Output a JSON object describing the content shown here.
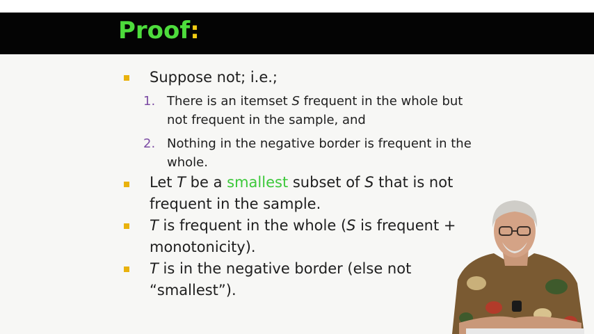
{
  "title": {
    "text": "Proof",
    "colon": ":"
  },
  "bullets": {
    "b1": "Suppose not; i.e.;",
    "n1_num": "1.",
    "n1_a": "There is an itemset ",
    "n1_S": "S",
    "n1_b": " frequent in the whole but",
    "n1_line2": "not frequent in the sample, and",
    "n2_num": "2.",
    "n2_line1": "Nothing in the negative border is frequent in the",
    "n2_line2": "whole.",
    "b2_a": "Let ",
    "b2_T": "T",
    "b2_b": " be a ",
    "b2_smallest": "smallest",
    "b2_c": " subset of ",
    "b2_S": "S",
    "b2_d": " that is not",
    "b2_line2": "frequent in the sample.",
    "b3_T": "T",
    "b3_a": " is frequent in the whole (",
    "b3_S": "S",
    "b3_b": " is frequent +",
    "b3_line2": "monotonicity).",
    "b4_T": "T",
    "b4_a": " is in the negative border (else not",
    "b4_line2": "“smallest”)."
  },
  "colors": {
    "title_green": "#4ddc3c",
    "colon_yellow": "#f2cd13",
    "bullet_gold": "#e9b20d",
    "number_purple": "#7c4ca4",
    "highlight_green": "#3cc83a"
  }
}
